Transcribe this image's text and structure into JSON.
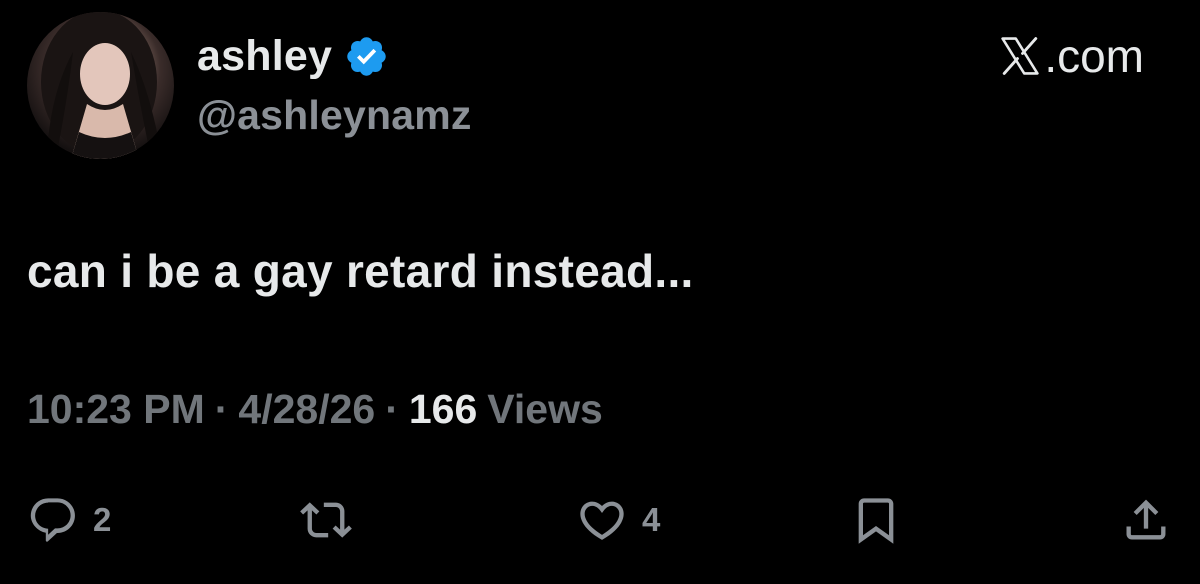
{
  "author": {
    "display_name": "ashley",
    "handle": "@ashleynamz",
    "verified": true,
    "avatar": "avatar-photo"
  },
  "brand": {
    "label": ".com",
    "icon": "x-logo-icon"
  },
  "tweet": {
    "text": "can i be a gay retard instead..."
  },
  "meta": {
    "time": "10:23 PM",
    "separator": "·",
    "date": "4/28/26",
    "views_count": "166",
    "views_label": "Views"
  },
  "actions": {
    "replies": {
      "icon": "reply-icon",
      "count": "2"
    },
    "reposts": {
      "icon": "repost-icon",
      "count": ""
    },
    "likes": {
      "icon": "heart-icon",
      "count": "4"
    },
    "bookmark": {
      "icon": "bookmark-icon"
    },
    "share": {
      "icon": "share-icon"
    }
  },
  "colors": {
    "background": "#000000",
    "primary_text": "#e7e9ea",
    "secondary_text": "#71767b",
    "verified_badge": "#1d9bf0"
  }
}
